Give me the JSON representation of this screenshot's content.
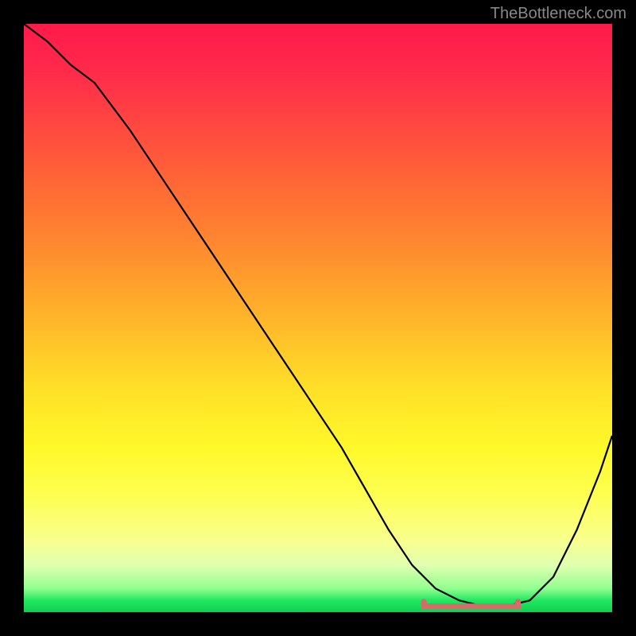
{
  "watermark": "TheBottleneck.com",
  "chart_data": {
    "type": "line",
    "title": "",
    "xlabel": "",
    "ylabel": "",
    "xlim": [
      0,
      100
    ],
    "ylim": [
      0,
      100
    ],
    "grid": false,
    "legend": false,
    "series": [
      {
        "name": "bottleneck-curve",
        "x": [
          0,
          4,
          8,
          12,
          18,
          24,
          30,
          36,
          42,
          48,
          54,
          58,
          62,
          66,
          70,
          74,
          78,
          82,
          86,
          90,
          94,
          98,
          100
        ],
        "values": [
          100,
          97,
          93,
          90,
          82,
          73,
          64,
          55,
          46,
          37,
          28,
          21,
          14,
          8,
          4,
          2,
          1,
          1,
          2,
          6,
          14,
          24,
          30
        ]
      }
    ],
    "optimal_range": {
      "x_start": 68,
      "x_end": 84,
      "y": 1
    },
    "background_gradient": {
      "top_color": "#ff1a4a",
      "mid_color": "#ffe028",
      "bottom_color": "#20e860"
    }
  }
}
